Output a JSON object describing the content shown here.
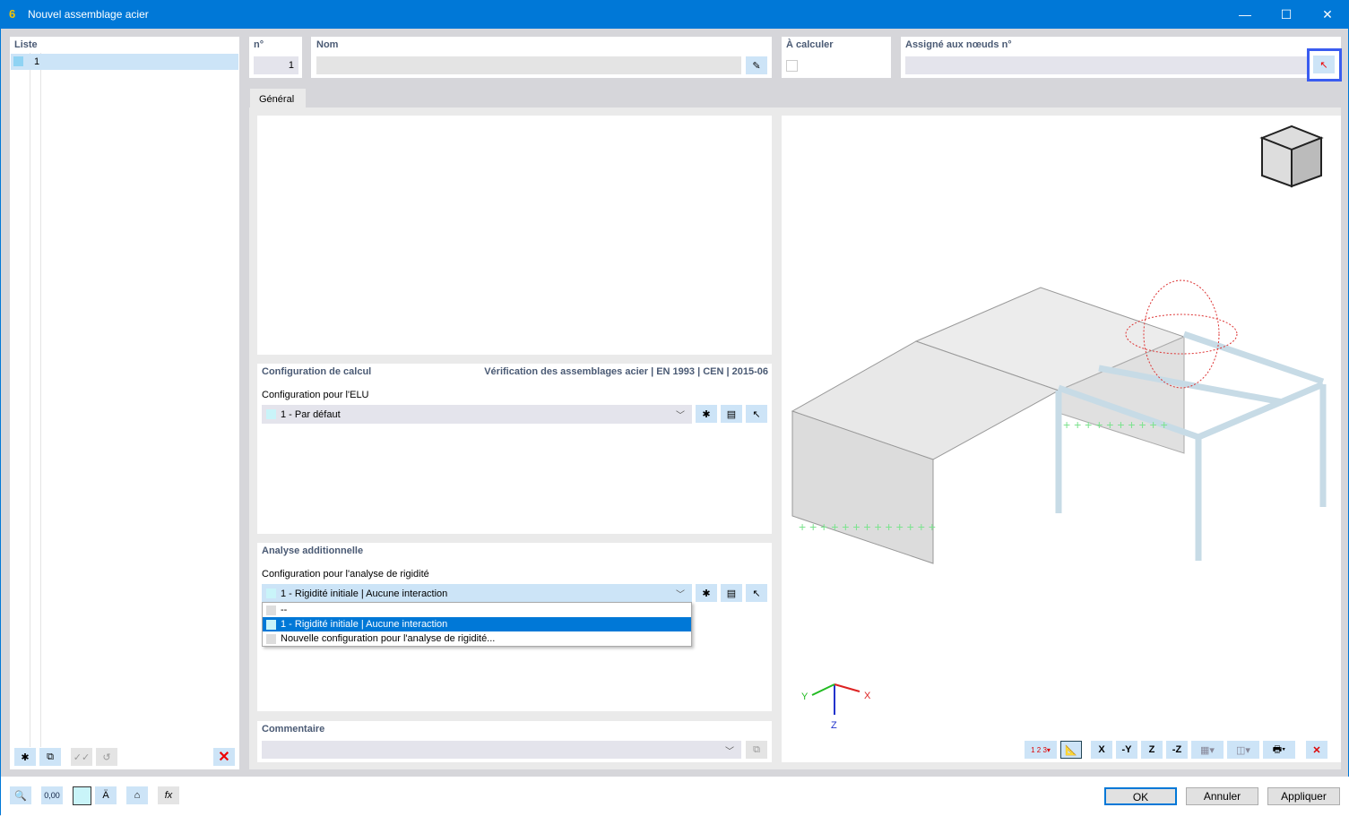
{
  "window": {
    "title": "Nouvel assemblage acier",
    "minimize": "—",
    "maximize": "☐",
    "close": "✕"
  },
  "list": {
    "header": "Liste",
    "items": [
      {
        "no": "1"
      }
    ]
  },
  "number": {
    "label": "n°",
    "value": "1"
  },
  "name": {
    "label": "Nom",
    "value": ""
  },
  "to_calculate": {
    "label": "À calculer",
    "checked": false
  },
  "assigned": {
    "label": "Assigné aux nœuds n°",
    "value": ""
  },
  "tabs": [
    {
      "label": "Général"
    }
  ],
  "calc_config": {
    "title": "Configuration de calcul",
    "standard": "Vérification des assemblages acier | EN 1993 | CEN | 2015-06",
    "uls_label": "Configuration pour l'ELU",
    "uls_value": "1 - Par défaut"
  },
  "additional": {
    "title": "Analyse additionnelle",
    "stiffness_label": "Configuration pour l'analyse de rigidité",
    "stiffness_value": "1 - Rigidité initiale | Aucune interaction",
    "options": [
      "--",
      "1 - Rigidité initiale | Aucune interaction",
      "Nouvelle configuration pour l'analyse de rigidité..."
    ]
  },
  "comment": {
    "title": "Commentaire",
    "value": ""
  },
  "axes": {
    "x": "X",
    "y": "Y",
    "z": "Z"
  },
  "view_toolbar": {
    "numbering": "1 2 3",
    "view_x": "X",
    "view_y": "-Y",
    "view_z": "Z",
    "view_mz": "-Z"
  },
  "buttons": {
    "ok": "OK",
    "cancel": "Annuler",
    "apply": "Appliquer"
  },
  "bottom_tools": {
    "units": "0,00"
  },
  "colors": {
    "accent": "#0078d7",
    "selection": "#cce4f7",
    "highlight": "#0078d7"
  }
}
